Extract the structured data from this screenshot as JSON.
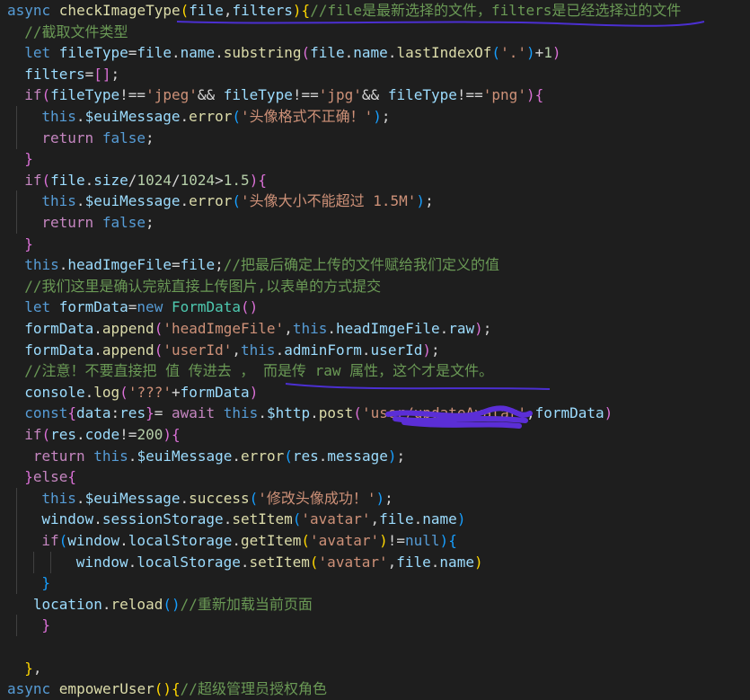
{
  "editor": {
    "lines": [
      {
        "indent": 0,
        "tokens": [
          [
            "kw",
            "async "
          ],
          [
            "fn",
            "checkImageType"
          ],
          [
            "br1",
            "("
          ],
          [
            "var",
            "file"
          ],
          [
            "txt",
            ","
          ],
          [
            "var",
            "filters"
          ],
          [
            "br1",
            ")"
          ],
          [
            "br1",
            "{"
          ],
          [
            "com",
            "//file是最新选择的文件，filters是已经选择过的文件"
          ]
        ]
      },
      {
        "indent": 1,
        "tokens": [
          [
            "com",
            "//截取文件类型"
          ]
        ]
      },
      {
        "indent": 1,
        "tokens": [
          [
            "kw",
            "let "
          ],
          [
            "var",
            "fileType"
          ],
          [
            "txt",
            "="
          ],
          [
            "var",
            "file"
          ],
          [
            "txt",
            "."
          ],
          [
            "var",
            "name"
          ],
          [
            "txt",
            "."
          ],
          [
            "fn",
            "substring"
          ],
          [
            "br2",
            "("
          ],
          [
            "var",
            "file"
          ],
          [
            "txt",
            "."
          ],
          [
            "var",
            "name"
          ],
          [
            "txt",
            "."
          ],
          [
            "fn",
            "lastIndexOf"
          ],
          [
            "br3",
            "("
          ],
          [
            "str",
            "'.'"
          ],
          [
            "br3",
            ")"
          ],
          [
            "txt",
            "+"
          ],
          [
            "num",
            "1"
          ],
          [
            "br2",
            ")"
          ]
        ]
      },
      {
        "indent": 1,
        "tokens": [
          [
            "var",
            "filters"
          ],
          [
            "txt",
            "="
          ],
          [
            "br2",
            "[]"
          ],
          [
            "txt",
            ";"
          ]
        ]
      },
      {
        "indent": 1,
        "tokens": [
          [
            "ctl",
            "if"
          ],
          [
            "br2",
            "("
          ],
          [
            "var",
            "fileType"
          ],
          [
            "txt",
            "!=="
          ],
          [
            "str",
            "'jpeg'"
          ],
          [
            "txt",
            "&& "
          ],
          [
            "var",
            "fileType"
          ],
          [
            "txt",
            "!=="
          ],
          [
            "str",
            "'jpg'"
          ],
          [
            "txt",
            "&& "
          ],
          [
            "var",
            "fileType"
          ],
          [
            "txt",
            "!=="
          ],
          [
            "str",
            "'png'"
          ],
          [
            "br2",
            ")"
          ],
          [
            "br2",
            "{"
          ]
        ]
      },
      {
        "indent": 2,
        "tokens": [
          [
            "kw",
            "this"
          ],
          [
            "txt",
            "."
          ],
          [
            "var",
            "$euiMessage"
          ],
          [
            "txt",
            "."
          ],
          [
            "fn",
            "error"
          ],
          [
            "br3",
            "("
          ],
          [
            "str",
            "'头像格式不正确！'"
          ],
          [
            "br3",
            ")"
          ],
          [
            "txt",
            ";"
          ]
        ]
      },
      {
        "indent": 2,
        "tokens": [
          [
            "ctl",
            "return "
          ],
          [
            "kw",
            "false"
          ],
          [
            "txt",
            ";"
          ]
        ]
      },
      {
        "indent": 1,
        "tokens": [
          [
            "br2",
            "}"
          ]
        ]
      },
      {
        "indent": 1,
        "tokens": [
          [
            "ctl",
            "if"
          ],
          [
            "br2",
            "("
          ],
          [
            "var",
            "file"
          ],
          [
            "txt",
            "."
          ],
          [
            "var",
            "size"
          ],
          [
            "txt",
            "/"
          ],
          [
            "num",
            "1024"
          ],
          [
            "txt",
            "/"
          ],
          [
            "num",
            "1024"
          ],
          [
            "txt",
            ">"
          ],
          [
            "num",
            "1.5"
          ],
          [
            "br2",
            ")"
          ],
          [
            "br2",
            "{"
          ]
        ]
      },
      {
        "indent": 2,
        "tokens": [
          [
            "kw",
            "this"
          ],
          [
            "txt",
            "."
          ],
          [
            "var",
            "$euiMessage"
          ],
          [
            "txt",
            "."
          ],
          [
            "fn",
            "error"
          ],
          [
            "br3",
            "("
          ],
          [
            "str",
            "'头像大小不能超过 1.5M'"
          ],
          [
            "br3",
            ")"
          ],
          [
            "txt",
            ";"
          ]
        ]
      },
      {
        "indent": 2,
        "tokens": [
          [
            "ctl",
            "return "
          ],
          [
            "kw",
            "false"
          ],
          [
            "txt",
            ";"
          ]
        ]
      },
      {
        "indent": 1,
        "tokens": [
          [
            "br2",
            "}"
          ]
        ]
      },
      {
        "indent": 1,
        "tokens": [
          [
            "kw",
            "this"
          ],
          [
            "txt",
            "."
          ],
          [
            "var",
            "headImgeFile"
          ],
          [
            "txt",
            "="
          ],
          [
            "var",
            "file"
          ],
          [
            "txt",
            ";"
          ],
          [
            "com",
            "//把最后确定上传的文件赋给我们定义的值"
          ]
        ]
      },
      {
        "indent": 1,
        "tokens": [
          [
            "com",
            "//我们这里是确认完就直接上传图片,以表单的方式提交"
          ]
        ]
      },
      {
        "indent": 1,
        "tokens": [
          [
            "kw",
            "let "
          ],
          [
            "var",
            "formData"
          ],
          [
            "txt",
            "="
          ],
          [
            "kw",
            "new "
          ],
          [
            "cls",
            "FormData"
          ],
          [
            "br2",
            "()"
          ]
        ]
      },
      {
        "indent": 1,
        "tokens": [
          [
            "var",
            "formData"
          ],
          [
            "txt",
            "."
          ],
          [
            "fn",
            "append"
          ],
          [
            "br2",
            "("
          ],
          [
            "str",
            "'headImgeFile'"
          ],
          [
            "txt",
            ","
          ],
          [
            "kw",
            "this"
          ],
          [
            "txt",
            "."
          ],
          [
            "var",
            "headImgeFile"
          ],
          [
            "txt",
            "."
          ],
          [
            "var",
            "raw"
          ],
          [
            "br2",
            ")"
          ],
          [
            "txt",
            ";"
          ]
        ]
      },
      {
        "indent": 1,
        "tokens": [
          [
            "var",
            "formData"
          ],
          [
            "txt",
            "."
          ],
          [
            "fn",
            "append"
          ],
          [
            "br2",
            "("
          ],
          [
            "str",
            "'userId'"
          ],
          [
            "txt",
            ","
          ],
          [
            "kw",
            "this"
          ],
          [
            "txt",
            "."
          ],
          [
            "var",
            "adminForm"
          ],
          [
            "txt",
            "."
          ],
          [
            "var",
            "userId"
          ],
          [
            "br2",
            ")"
          ],
          [
            "txt",
            ";"
          ]
        ]
      },
      {
        "indent": 1,
        "tokens": [
          [
            "com",
            "//注意！不要直接把 值 传进去 ， 而是传 raw 属性，这个才是文件。"
          ]
        ]
      },
      {
        "indent": 1,
        "tokens": [
          [
            "var",
            "console"
          ],
          [
            "txt",
            "."
          ],
          [
            "fn",
            "log"
          ],
          [
            "br2",
            "("
          ],
          [
            "str",
            "'???'"
          ],
          [
            "txt",
            "+"
          ],
          [
            "var",
            "formData"
          ],
          [
            "br2",
            ")"
          ]
        ]
      },
      {
        "indent": 1,
        "tokens": [
          [
            "kw",
            "const"
          ],
          [
            "br2",
            "{"
          ],
          [
            "var",
            "data"
          ],
          [
            "txt",
            ":"
          ],
          [
            "var",
            "res"
          ],
          [
            "br2",
            "}"
          ],
          [
            "txt",
            "= "
          ],
          [
            "ctl",
            "await "
          ],
          [
            "kw",
            "this"
          ],
          [
            "txt",
            "."
          ],
          [
            "var",
            "$http"
          ],
          [
            "txt",
            "."
          ],
          [
            "fn",
            "post"
          ],
          [
            "br2",
            "("
          ],
          [
            "str",
            "'user/updateAvatar'"
          ],
          [
            "txt",
            ","
          ],
          [
            "var",
            "formData"
          ],
          [
            "br2",
            ")"
          ]
        ]
      },
      {
        "indent": 1,
        "tokens": [
          [
            "ctl",
            "if"
          ],
          [
            "br2",
            "("
          ],
          [
            "var",
            "res"
          ],
          [
            "txt",
            "."
          ],
          [
            "var",
            "code"
          ],
          [
            "txt",
            "!="
          ],
          [
            "num",
            "200"
          ],
          [
            "br2",
            ")"
          ],
          [
            "br2",
            "{"
          ]
        ]
      },
      {
        "indent": 1,
        "tokens": [
          [
            "txt",
            " "
          ],
          [
            "ctl",
            "return "
          ],
          [
            "kw",
            "this"
          ],
          [
            "txt",
            "."
          ],
          [
            "var",
            "$euiMessage"
          ],
          [
            "txt",
            "."
          ],
          [
            "fn",
            "error"
          ],
          [
            "br3",
            "("
          ],
          [
            "var",
            "res"
          ],
          [
            "txt",
            "."
          ],
          [
            "var",
            "message"
          ],
          [
            "br3",
            ")"
          ],
          [
            "txt",
            ";"
          ]
        ]
      },
      {
        "indent": 1,
        "tokens": [
          [
            "br2",
            "}"
          ],
          [
            "ctl",
            "else"
          ],
          [
            "br2",
            "{"
          ]
        ]
      },
      {
        "indent": 2,
        "tokens": [
          [
            "kw",
            "this"
          ],
          [
            "txt",
            "."
          ],
          [
            "var",
            "$euiMessage"
          ],
          [
            "txt",
            "."
          ],
          [
            "fn",
            "success"
          ],
          [
            "br3",
            "("
          ],
          [
            "str",
            "'修改头像成功！'"
          ],
          [
            "br3",
            ")"
          ],
          [
            "txt",
            ";"
          ]
        ]
      },
      {
        "indent": 2,
        "tokens": [
          [
            "var",
            "window"
          ],
          [
            "txt",
            "."
          ],
          [
            "var",
            "sessionStorage"
          ],
          [
            "txt",
            "."
          ],
          [
            "fn",
            "setItem"
          ],
          [
            "br3",
            "("
          ],
          [
            "str",
            "'avatar'"
          ],
          [
            "txt",
            ","
          ],
          [
            "var",
            "file"
          ],
          [
            "txt",
            "."
          ],
          [
            "var",
            "name"
          ],
          [
            "br3",
            ")"
          ]
        ]
      },
      {
        "indent": 2,
        "tokens": [
          [
            "ctl",
            "if"
          ],
          [
            "br3",
            "("
          ],
          [
            "var",
            "window"
          ],
          [
            "txt",
            "."
          ],
          [
            "var",
            "localStorage"
          ],
          [
            "txt",
            "."
          ],
          [
            "fn",
            "getItem"
          ],
          [
            "br1",
            "("
          ],
          [
            "str",
            "'avatar'"
          ],
          [
            "br1",
            ")"
          ],
          [
            "txt",
            "!="
          ],
          [
            "kw",
            "null"
          ],
          [
            "br3",
            ")"
          ],
          [
            "br3",
            "{"
          ]
        ]
      },
      {
        "indent": 4,
        "tokens": [
          [
            "var",
            "window"
          ],
          [
            "txt",
            "."
          ],
          [
            "var",
            "localStorage"
          ],
          [
            "txt",
            "."
          ],
          [
            "fn",
            "setItem"
          ],
          [
            "br1",
            "("
          ],
          [
            "str",
            "'avatar'"
          ],
          [
            "txt",
            ","
          ],
          [
            "var",
            "file"
          ],
          [
            "txt",
            "."
          ],
          [
            "var",
            "name"
          ],
          [
            "br1",
            ")"
          ]
        ]
      },
      {
        "indent": 2,
        "tokens": [
          [
            "br3",
            "}"
          ]
        ]
      },
      {
        "indent": 1,
        "tokens": [
          [
            "txt",
            " "
          ],
          [
            "var",
            "location"
          ],
          [
            "txt",
            "."
          ],
          [
            "fn",
            "reload"
          ],
          [
            "br3",
            "()"
          ],
          [
            "com",
            "//重新加载当前页面"
          ]
        ]
      },
      {
        "indent": 2,
        "tokens": [
          [
            "br2",
            "}"
          ]
        ]
      },
      {
        "indent": 0,
        "tokens": []
      },
      {
        "indent": 1,
        "tokens": [
          [
            "br1",
            "}"
          ],
          [
            "txt",
            ","
          ]
        ]
      },
      {
        "indent": 0,
        "tokens": [
          [
            "kw",
            "async "
          ],
          [
            "fn",
            "empowerUser"
          ],
          [
            "br1",
            "()"
          ],
          [
            "br1",
            "{"
          ],
          [
            "com",
            "//超级管理员授权角色"
          ]
        ]
      }
    ]
  },
  "colors": {
    "background": "#1e1e1e",
    "annotation_ink": "#4b2fd1",
    "redaction_ink": "#5b2ed6"
  }
}
